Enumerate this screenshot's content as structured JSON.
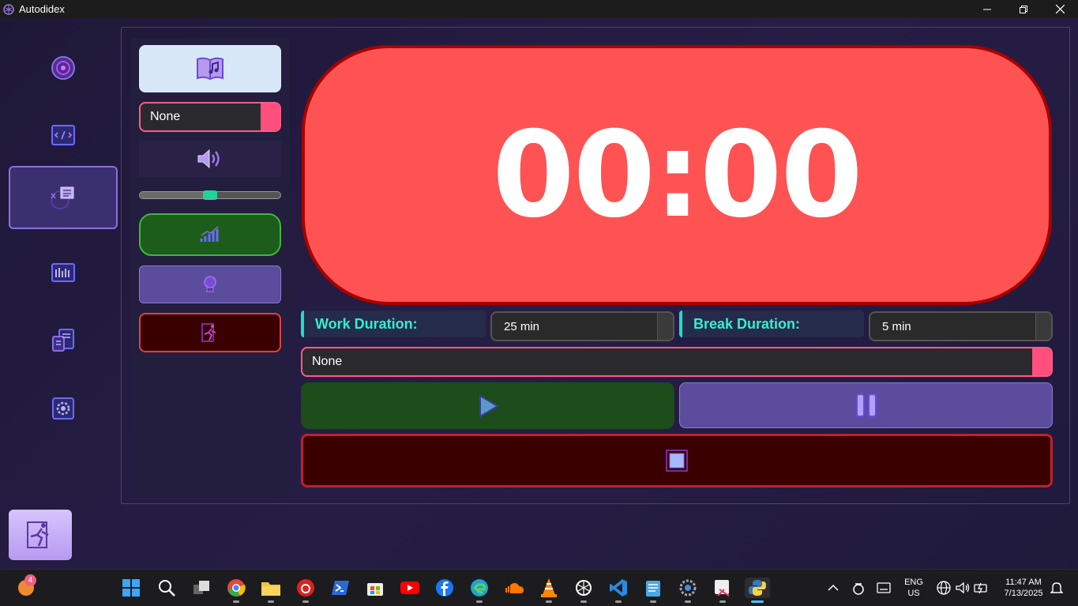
{
  "window": {
    "title": "Autodidex"
  },
  "music": {
    "playlist_value": "None"
  },
  "timer": {
    "display": "00:00"
  },
  "settings": {
    "work_label": "Work Duration:",
    "work_value": "25 min",
    "break_label": "Break Duration:",
    "break_value": "5 min",
    "task_value": "None"
  },
  "volume": {
    "level": 0.5
  },
  "colors": {
    "accent": "#8a6fe0",
    "timer_bg": "#ff5252",
    "play_bg": "#1c4d1a",
    "pause_bg": "#5c4c9e",
    "stop_bg": "#3a0000",
    "label_color": "#32f0d0"
  },
  "taskbar": {
    "badge_count": "4",
    "lang": "ENG",
    "region": "US",
    "time": "11:47 AM",
    "date": "7/13/2025"
  }
}
